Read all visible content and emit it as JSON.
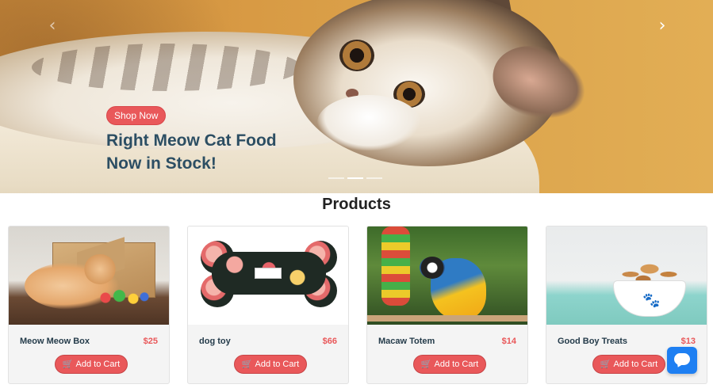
{
  "hero": {
    "shop_now_label": "Shop Now",
    "title_line1": "Right Meow Cat Food",
    "title_line2": "Now in Stock!",
    "prev_arrow": "‹",
    "next_arrow": "›",
    "slide_count": 3,
    "active_slide": 2
  },
  "products_section": {
    "title": "Products"
  },
  "products": [
    {
      "name": "Meow Meow Box",
      "price": "$25",
      "button_label": "Add to Cart"
    },
    {
      "name": "dog toy",
      "price": "$66",
      "button_label": "Add to Cart"
    },
    {
      "name": "Macaw Totem",
      "price": "$14",
      "button_label": "Add to Cart"
    },
    {
      "name": "Good Boy Treats",
      "price": "$13",
      "button_label": "Add to Cart"
    }
  ],
  "colors": {
    "accent": "#e9585a",
    "title_text": "#2c4e63",
    "chat_button": "#1e7ff2"
  },
  "icons": {
    "cart": "cart-icon",
    "chat": "chat-icon",
    "prev": "chevron-left-icon",
    "next": "chevron-right-icon"
  }
}
